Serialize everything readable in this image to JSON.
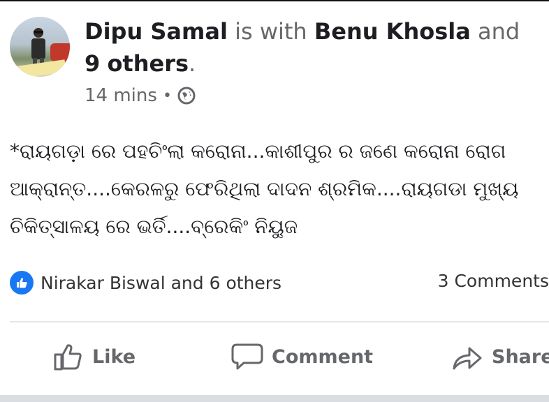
{
  "post": {
    "author": "Dipu Samal",
    "with_text": "is with",
    "tagged": "Benu Khosla",
    "and_text": "and",
    "others_count": "9",
    "others_text": "others",
    "period": ".",
    "time": "14 mins",
    "separator": "•",
    "privacy_icon": "globe-icon",
    "text_lines": [
      "*ରାୟଗଡ଼ା ରେ ପହଚିଂଲା କରୋନା...କାଶୀପୁର ର ଜଣେ କରୋନା ରୋଗ",
      "ଆକ୍ରାନ୍ତ....କେରଳରୁ ଫେରିଥିଲା ଦାଦନ ଶ୍ରମିକ....ରାୟଗଡା ମୁଖ୍ୟ",
      "ଚିକିତ୍ସାଳୟ ରେ ଭର୍ତି....ବ୍ରେକିଂ ନିୟୁଜ"
    ]
  },
  "reactions": {
    "icon": "like-icon",
    "text": "Nirakar Biswal and 6 others",
    "comments": "3 Comments"
  },
  "actions": {
    "like": "Like",
    "comment": "Comment",
    "share": "Share"
  },
  "colors": {
    "accent": "#1877f2",
    "muted": "#65676b"
  }
}
